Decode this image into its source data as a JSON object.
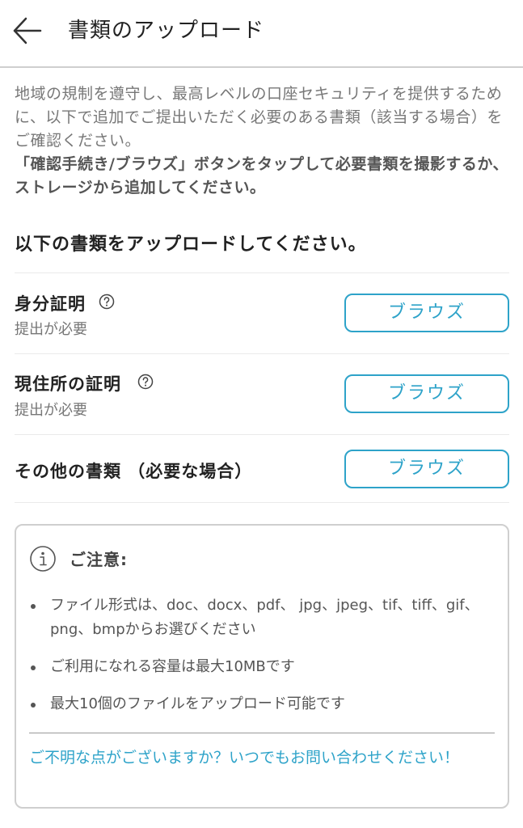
{
  "header": {
    "title": "書類のアップロード"
  },
  "intro": {
    "text": "地域の規制を遵守し、最高レベルの口座セキュリティを提供するために、以下で追加でご提出いただく必要のある書類（該当する場合）をご確認ください。",
    "bold_text": "「確認手続き/ブラウズ」ボタンをタップして必要書類を撮影するか、ストレージから追加してください。"
  },
  "section_title": "以下の書類をアップロードしてください。",
  "documents": [
    {
      "name": "身分証明",
      "sub": "提出が必要",
      "button": "ブラウズ"
    },
    {
      "name": "現住所の証明",
      "sub": "提出が必要",
      "button": "ブラウズ"
    },
    {
      "name": "その他の書類 （必要な場合）",
      "button": "ブラウズ"
    }
  ],
  "notice": {
    "title": "ご注意:",
    "items": [
      "ファイル形式は、doc、docx、pdf、 jpg、jpeg、tif、tiff、gif、png、bmpからお選びください",
      "ご利用になれる容量は最大10MBです",
      "最大10個のファイルをアップロード可能です"
    ],
    "contact": "ご不明な点がございますか？いつでもお問い合わせください！"
  },
  "colors": {
    "accent": "#2ea3c9",
    "text": "#222222",
    "muted": "#777777",
    "border": "#cfcfcf"
  }
}
